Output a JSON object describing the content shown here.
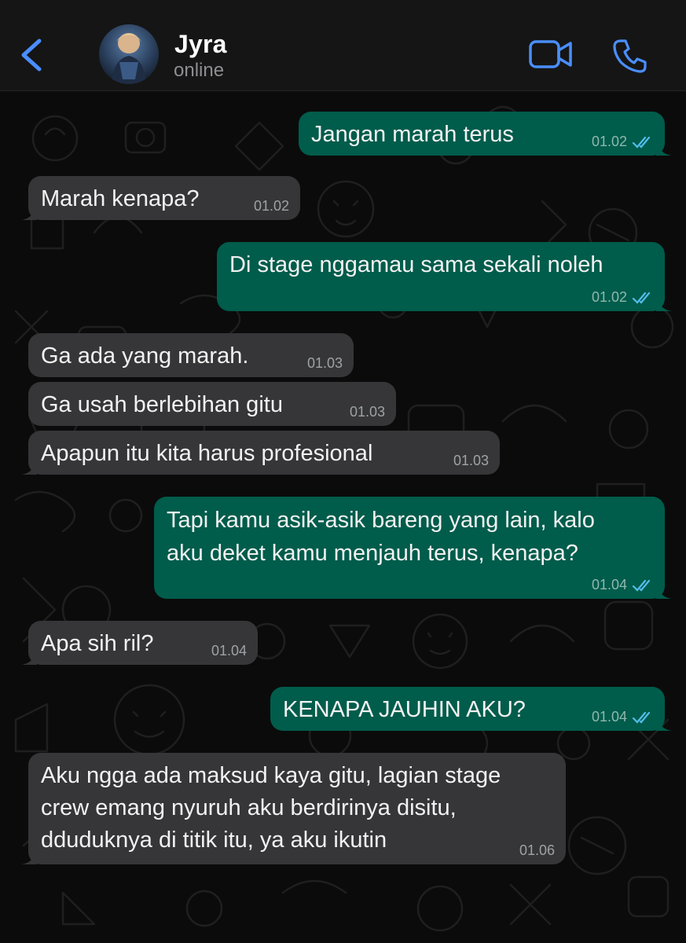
{
  "header": {
    "contact_name": "Jyra",
    "status": "online",
    "back_icon": "chevron-left-icon",
    "video_icon": "video-camera-icon",
    "call_icon": "phone-icon"
  },
  "colors": {
    "accent": "#4a8eff",
    "incoming_bubble": "#363638",
    "outgoing_bubble": "#005c4b",
    "read_tick": "#53bdeb"
  },
  "messages": [
    {
      "direction": "out",
      "text": "Jangan marah terus",
      "time": "01.02",
      "read": true
    },
    {
      "direction": "in",
      "text": "Marah kenapa?",
      "time": "01.02"
    },
    {
      "direction": "out",
      "text": "Di stage nggamau sama sekali noleh",
      "time": "01.02",
      "read": true
    },
    {
      "direction": "in",
      "text": "Ga ada yang marah.",
      "time": "01.03"
    },
    {
      "direction": "in",
      "text": "Ga usah berlebihan gitu",
      "time": "01.03"
    },
    {
      "direction": "in",
      "text": "Apapun itu kita harus profesional",
      "time": "01.03"
    },
    {
      "direction": "out",
      "lines": [
        "Tapi kamu asik-asik bareng yang lain, kalo",
        "aku deket kamu menjauh terus, kenapa?"
      ],
      "time": "01.04",
      "read": true
    },
    {
      "direction": "in",
      "text": "Apa sih ril?",
      "time": "01.04"
    },
    {
      "direction": "out",
      "text": "KENAPA JAUHIN AKU?",
      "time": "01.04",
      "read": true
    },
    {
      "direction": "in",
      "lines": [
        "Aku ngga ada maksud kaya gitu, lagian stage",
        "crew emang nyuruh aku berdirinya disitu,",
        "dduduknya di titik itu, ya aku ikutin"
      ],
      "time": "01.06"
    }
  ]
}
